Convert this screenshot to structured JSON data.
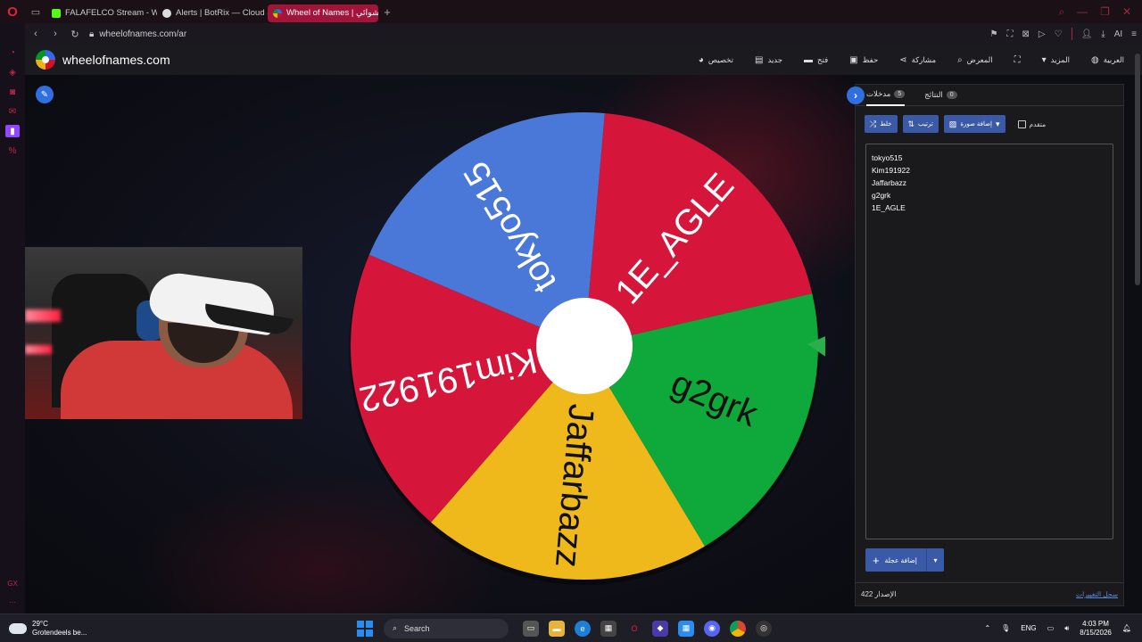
{
  "browser": {
    "tabs": [
      {
        "label": "FALAFELCO Stream - Watc",
        "color": "#53fc18",
        "active": false
      },
      {
        "label": "Alerts | BotRix — Cloud St",
        "color": "#ffffff",
        "active": false
      },
      {
        "label": "Wheel of Names | العشوائي",
        "color": "#ffffff",
        "active": true
      }
    ],
    "new_tab": "+",
    "url": "wheelofnames.com/ar",
    "ai_label": "AI"
  },
  "header": {
    "site_title": "wheelofnames.com",
    "menu": [
      {
        "label": "تخصيص",
        "icon": "palette-icon"
      },
      {
        "label": "جديد",
        "icon": "file-icon"
      },
      {
        "label": "فتح",
        "icon": "folder-icon"
      },
      {
        "label": "حفظ",
        "icon": "save-icon"
      },
      {
        "label": "مشاركة",
        "icon": "share-icon"
      },
      {
        "label": "المعرض",
        "icon": "search-icon"
      },
      {
        "label": "",
        "icon": "fullscreen-icon"
      },
      {
        "label": "المزيد",
        "icon": "caret-down-icon"
      },
      {
        "label": "العربية",
        "icon": "globe-icon"
      }
    ]
  },
  "wheel": {
    "segments": [
      {
        "label": "1E_AGLE",
        "color": "#d5163a"
      },
      {
        "label": "g2grk",
        "color": "#0fa83a"
      },
      {
        "label": "Jaffarbazz",
        "color": "#f0b91b"
      },
      {
        "label": "Kim191922",
        "color": "#d5163a"
      },
      {
        "label": "tokyo515",
        "color": "#4a78d8"
      }
    ],
    "pointer_color": "#2ab04a"
  },
  "panel": {
    "tabs": [
      {
        "label": "مدخلات",
        "count": "5",
        "active": true
      },
      {
        "label": "النتائج",
        "count": "0",
        "active": false
      }
    ],
    "toolbar": {
      "shuffle": "خلط",
      "sort": "ترتيب",
      "add_image": "إضافة صورة",
      "advanced": "متقدم"
    },
    "entries": [
      "tokyo515",
      "Kim191922",
      "Jaffarbazz",
      "g2grk",
      "1E_AGLE"
    ],
    "add_wheel": "إضافة عجلة",
    "version": "الإصدار 422",
    "changelog": "سجل التغييرات"
  },
  "taskbar": {
    "weather_temp": "29°C",
    "weather_desc": "Grotendeels be...",
    "search": "Search",
    "lang": "ENG",
    "time": "4:03 PM",
    "date": "8/15/2026"
  }
}
